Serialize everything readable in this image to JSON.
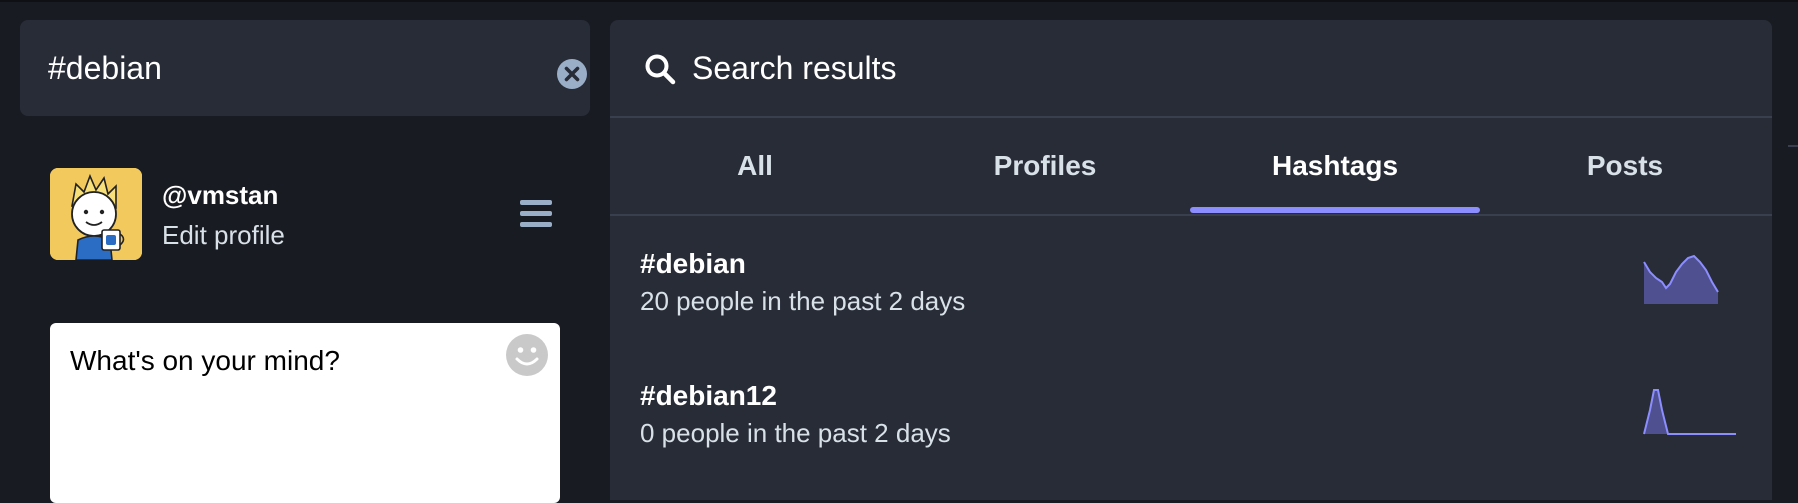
{
  "search": {
    "value": "#debian",
    "clear_icon": "close-circle-icon"
  },
  "profile": {
    "username": "@vmstan",
    "edit_label": "Edit profile",
    "avatar_icon": "cartoon-avatar-with-mug",
    "menu_icon": "hamburger-icon"
  },
  "compose": {
    "placeholder": "What's on your mind?",
    "emoji_icon": "smiley-icon"
  },
  "results": {
    "title": "Search results",
    "icon": "search-icon",
    "tabs": [
      {
        "label": "All",
        "active": false
      },
      {
        "label": "Profiles",
        "active": false
      },
      {
        "label": "Hashtags",
        "active": true
      },
      {
        "label": "Posts",
        "active": false
      }
    ],
    "hashtags": [
      {
        "name": "#debian",
        "subtitle": "20 people in the past 2 days",
        "trend": "wave"
      },
      {
        "name": "#debian12",
        "subtitle": "0 people in the past 2 days",
        "trend": "spike"
      }
    ]
  },
  "colors": {
    "background": "#191b22",
    "panel": "#282c37",
    "accent": "#8c8dff",
    "text_secondary": "#d9e1e8"
  }
}
